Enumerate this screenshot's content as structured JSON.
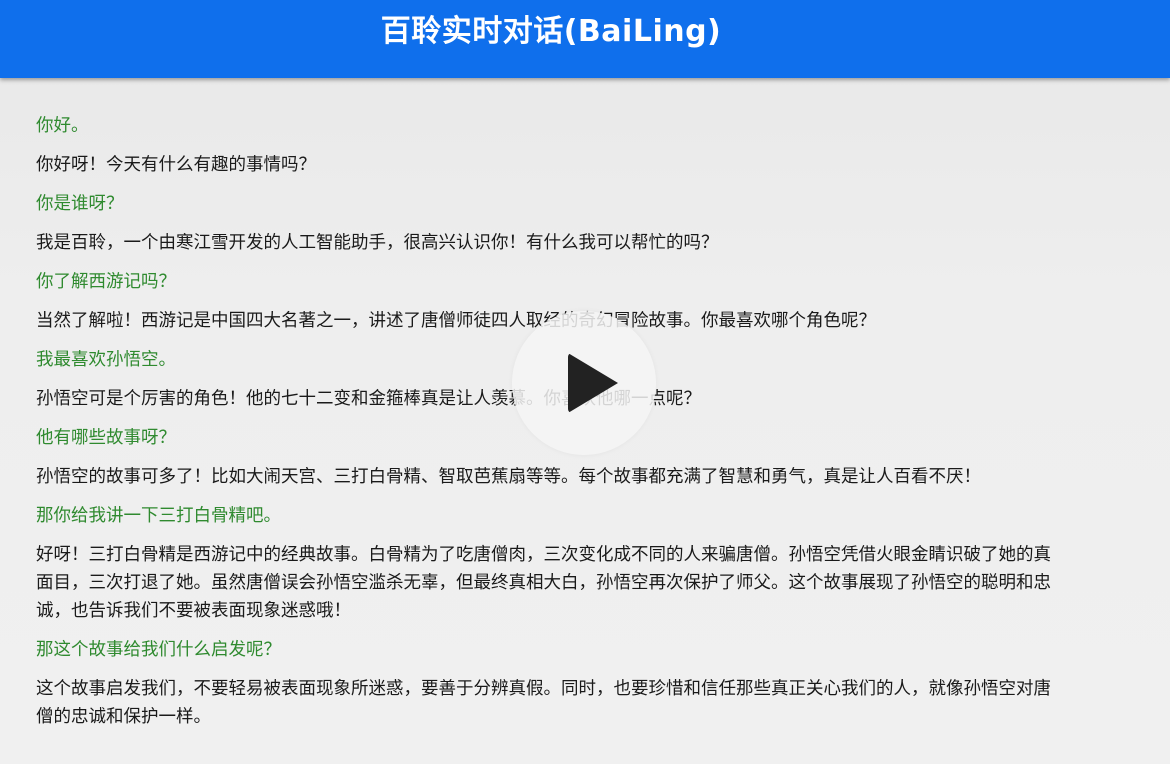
{
  "header": {
    "title": "百聆实时对话(BaiLing)"
  },
  "colors": {
    "header_bg": "#0f6fec",
    "user_text": "#2f8a2f",
    "bot_text": "#1a1a1a"
  },
  "messages": [
    {
      "role": "user",
      "text": "你好。"
    },
    {
      "role": "bot",
      "text": "你好呀！今天有什么有趣的事情吗？"
    },
    {
      "role": "user",
      "text": "你是谁呀？"
    },
    {
      "role": "bot",
      "text": "我是百聆，一个由寒江雪开发的人工智能助手，很高兴认识你！有什么我可以帮忙的吗？"
    },
    {
      "role": "user",
      "text": "你了解西游记吗？"
    },
    {
      "role": "bot",
      "text": "当然了解啦！西游记是中国四大名著之一，讲述了唐僧师徒四人取经的奇幻冒险故事。你最喜欢哪个角色呢？"
    },
    {
      "role": "user",
      "text": "我最喜欢孙悟空。"
    },
    {
      "role": "bot",
      "text": "孙悟空可是个厉害的角色！他的七十二变和金箍棒真是让人羡慕。你喜欢他哪一点呢？"
    },
    {
      "role": "user",
      "text": "他有哪些故事呀？"
    },
    {
      "role": "bot",
      "text": "孙悟空的故事可多了！比如大闹天宫、三打白骨精、智取芭蕉扇等等。每个故事都充满了智慧和勇气，真是让人百看不厌！"
    },
    {
      "role": "user",
      "text": "那你给我讲一下三打白骨精吧。"
    },
    {
      "role": "bot",
      "text": "好呀！三打白骨精是西游记中的经典故事。白骨精为了吃唐僧肉，三次变化成不同的人来骗唐僧。孙悟空凭借火眼金睛识破了她的真面目，三次打退了她。虽然唐僧误会孙悟空滥杀无辜，但最终真相大白，孙悟空再次保护了师父。这个故事展现了孙悟空的聪明和忠诚，也告诉我们不要被表面现象迷惑哦！"
    },
    {
      "role": "user",
      "text": "那这个故事给我们什么启发呢？"
    },
    {
      "role": "bot",
      "text": "这个故事启发我们，不要轻易被表面现象所迷惑，要善于分辨真假。同时，也要珍惜和信任那些真正关心我们的人，就像孙悟空对唐僧的忠诚和保护一样。"
    }
  ],
  "overlay": {
    "icon": "play-icon"
  }
}
